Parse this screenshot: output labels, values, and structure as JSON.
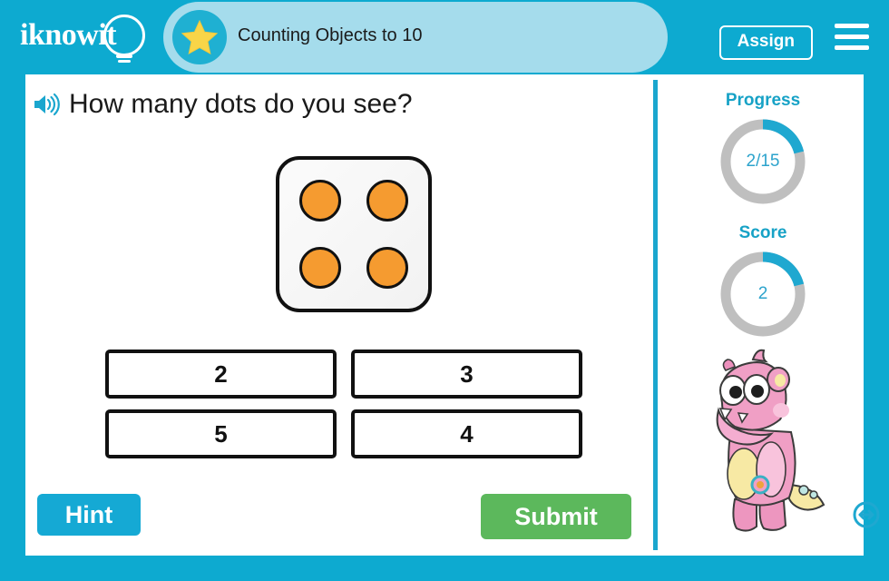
{
  "header": {
    "logo_text": "iknowit",
    "logo_icon": "lightbulb-icon",
    "star_icon": "star-icon",
    "lesson_title": "Counting Objects to 10",
    "assign_label": "Assign",
    "menu_icon": "hamburger-menu-icon",
    "band_color": "#A5DCEC",
    "bar_color": "#0DAAD0"
  },
  "question": {
    "audio_icon": "speaker-icon",
    "text": "How many dots do you see?"
  },
  "stimulus": {
    "type": "dice-face",
    "dot_count": 4,
    "dot_color": "#F59B30",
    "face_color": "#f7f7f7",
    "dot_positions": [
      "top-left",
      "top-right",
      "bottom-left",
      "bottom-right"
    ]
  },
  "choices": [
    {
      "label": "2",
      "selected": false
    },
    {
      "label": "3",
      "selected": false
    },
    {
      "label": "5",
      "selected": false
    },
    {
      "label": "4",
      "selected": false
    }
  ],
  "actions": {
    "hint_label": "Hint",
    "hint_color": "#15A9D4",
    "submit_label": "Submit",
    "submit_color": "#5CB85C"
  },
  "sidebar": {
    "progress": {
      "label": "Progress",
      "value_text": "2/15",
      "current": 2,
      "total": 15,
      "percent": 21,
      "arc_color": "#1FA8D0",
      "track_color": "#BFBFBF"
    },
    "score": {
      "label": "Score",
      "value_text": "2",
      "current": 2,
      "percent": 21,
      "arc_color": "#1FA8D0",
      "track_color": "#BFBFBF"
    },
    "mascot": {
      "name": "pink-monster-mascot",
      "body_color": "#F2A3C7",
      "belly_color": "#F6E8A0"
    },
    "resize_icon": "resize-horizontal-icon",
    "resize_color": "#1FA8D0"
  }
}
